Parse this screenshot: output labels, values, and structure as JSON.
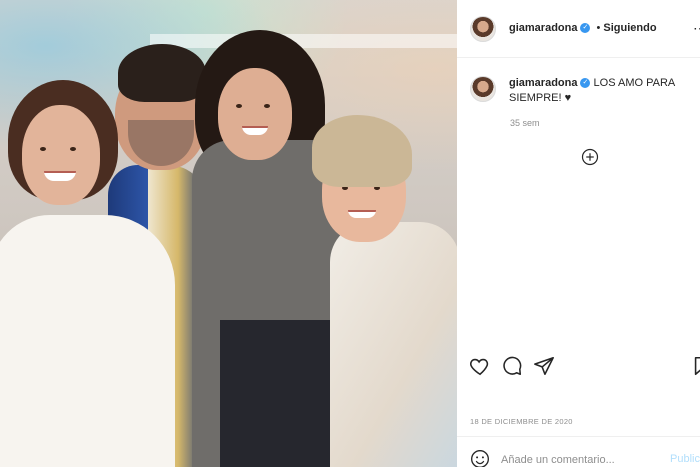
{
  "post": {
    "username": "giamaradona",
    "follow_status": "Siguiendo",
    "separator": "•",
    "caption_text": "LOS AMO PARA SIEMPRE! ♥",
    "time_ago": "35 sem",
    "date": "18 DE DICIEMBRE DE 2020"
  },
  "comment": {
    "placeholder": "Añade un comentario...",
    "publish_label": "Publicar"
  },
  "colors": {
    "verified": "#3897f0",
    "publish_disabled": "#b2dffc"
  },
  "icons": {
    "verified": "verified-badge-icon",
    "more": "more-options-icon",
    "plus": "add-circle-icon",
    "like": "heart-icon",
    "comment": "comment-bubble-icon",
    "share": "paper-plane-icon",
    "save": "bookmark-icon",
    "emoji": "emoji-icon"
  }
}
